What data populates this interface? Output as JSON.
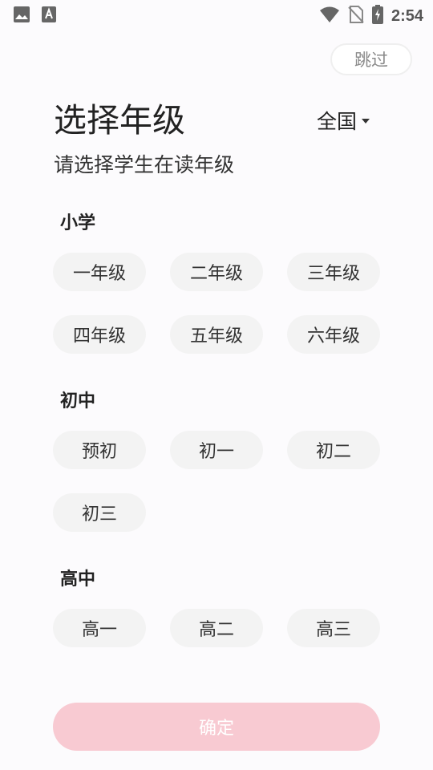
{
  "status_bar": {
    "time": "2:54",
    "icons_left": [
      "image-icon",
      "text-a-icon"
    ],
    "icons_right": [
      "wifi-icon",
      "no-sim-icon",
      "battery-charging-icon"
    ]
  },
  "header": {
    "skip_label": "跳过",
    "title": "选择年级",
    "region_label": "全国",
    "subtitle": "请选择学生在读年级"
  },
  "sections": {
    "primary": {
      "title": "小学",
      "grades": [
        "一年级",
        "二年级",
        "三年级",
        "四年级",
        "五年级",
        "六年级"
      ]
    },
    "junior": {
      "title": "初中",
      "grades": [
        "预初",
        "初一",
        "初二",
        "初三"
      ]
    },
    "senior": {
      "title": "高中",
      "grades": [
        "高一",
        "高二",
        "高三"
      ]
    }
  },
  "footer": {
    "confirm_label": "确定"
  },
  "colors": {
    "chip_bg": "#f3f3f3",
    "confirm_bg": "#f8cad2",
    "page_bg": "#fcfbfd"
  }
}
